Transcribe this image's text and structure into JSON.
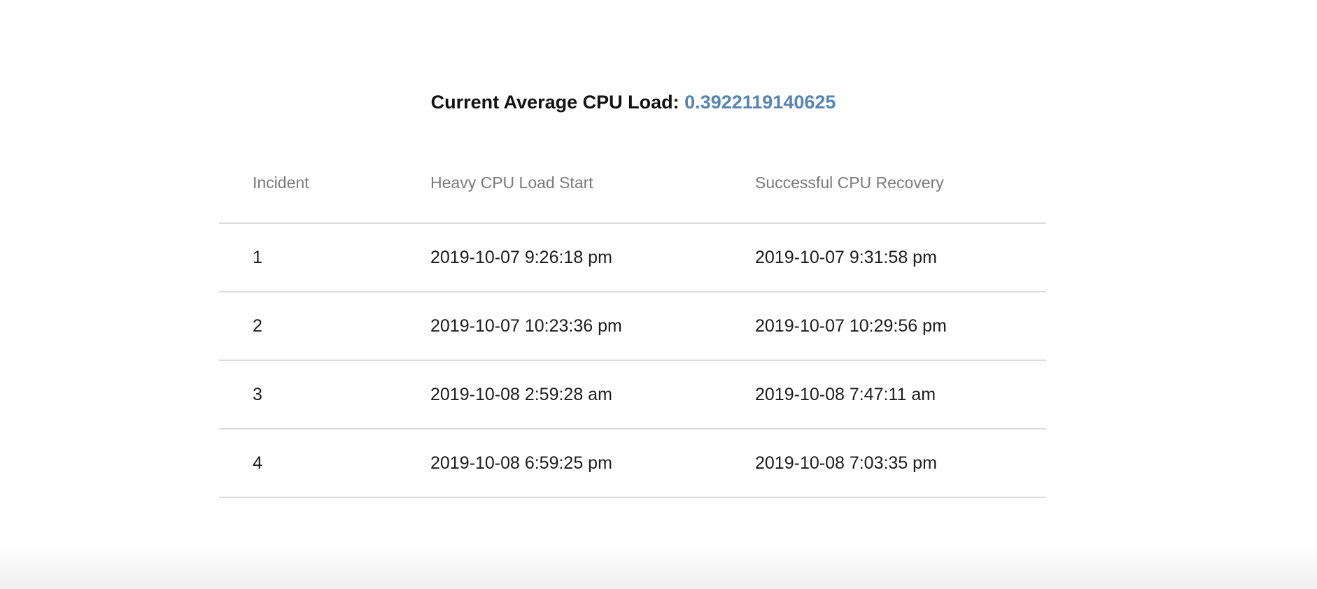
{
  "headline": {
    "label": "Current Average CPU Load:",
    "value": "0.3922119140625"
  },
  "table": {
    "columns": [
      "Incident",
      "Heavy CPU Load Start",
      "Successful CPU Recovery"
    ],
    "rows": [
      [
        "1",
        "2019-10-07 9:26:18 pm",
        "2019-10-07 9:31:58 pm"
      ],
      [
        "2",
        "2019-10-07 10:23:36 pm",
        "2019-10-07 10:29:56 pm"
      ],
      [
        "3",
        "2019-10-08 2:59:28 am",
        "2019-10-08 7:47:11 am"
      ],
      [
        "4",
        "2019-10-08 6:59:25 pm",
        "2019-10-08 7:03:35 pm"
      ]
    ]
  },
  "colors": {
    "accent": "#5585b5",
    "header_text": "#7a7a7a",
    "divider": "#dcdcdc"
  }
}
